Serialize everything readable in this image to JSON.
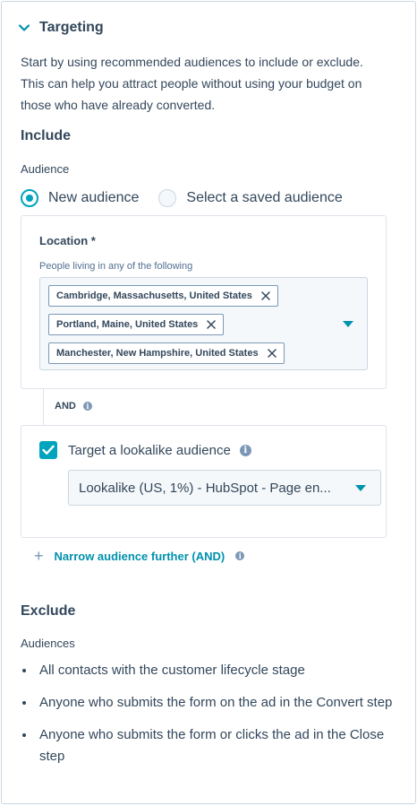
{
  "section": {
    "title": "Targeting",
    "description": "Start by using recommended audiences to include or exclude. This can help you attract people without using your budget on those who have already converted."
  },
  "include": {
    "heading": "Include",
    "audience_label": "Audience",
    "radio_options": [
      {
        "label": "New audience",
        "checked": true
      },
      {
        "label": "Select a saved audience",
        "checked": false
      }
    ],
    "location": {
      "label": "Location *",
      "help": "People living in any of the following",
      "tags": [
        "Cambridge, Massachusetts, United States",
        "Portland, Maine, United States",
        "Manchester, New Hampshire, United States"
      ]
    },
    "and_label": "AND",
    "lookalike": {
      "checkbox_label": "Target a lookalike audience",
      "checked": true,
      "selected_value": "Lookalike (US, 1%) - HubSpot - Page en..."
    },
    "narrow_link": "Narrow audience further (AND)"
  },
  "exclude": {
    "heading": "Exclude",
    "audiences_label": "Audiences",
    "items": [
      "All contacts with the customer lifecycle stage",
      "Anyone who submits the form on the ad in the Convert step",
      "Anyone who submits the form or clicks the ad in the Close step"
    ]
  },
  "colors": {
    "accent": "#00a4bd",
    "link": "#0091ae",
    "text": "#33475b",
    "border": "#cbd6e2"
  },
  "icons": [
    "chevron-down-icon",
    "close-icon",
    "caret-down-icon",
    "info-icon",
    "checkmark-icon",
    "plus-icon"
  ]
}
